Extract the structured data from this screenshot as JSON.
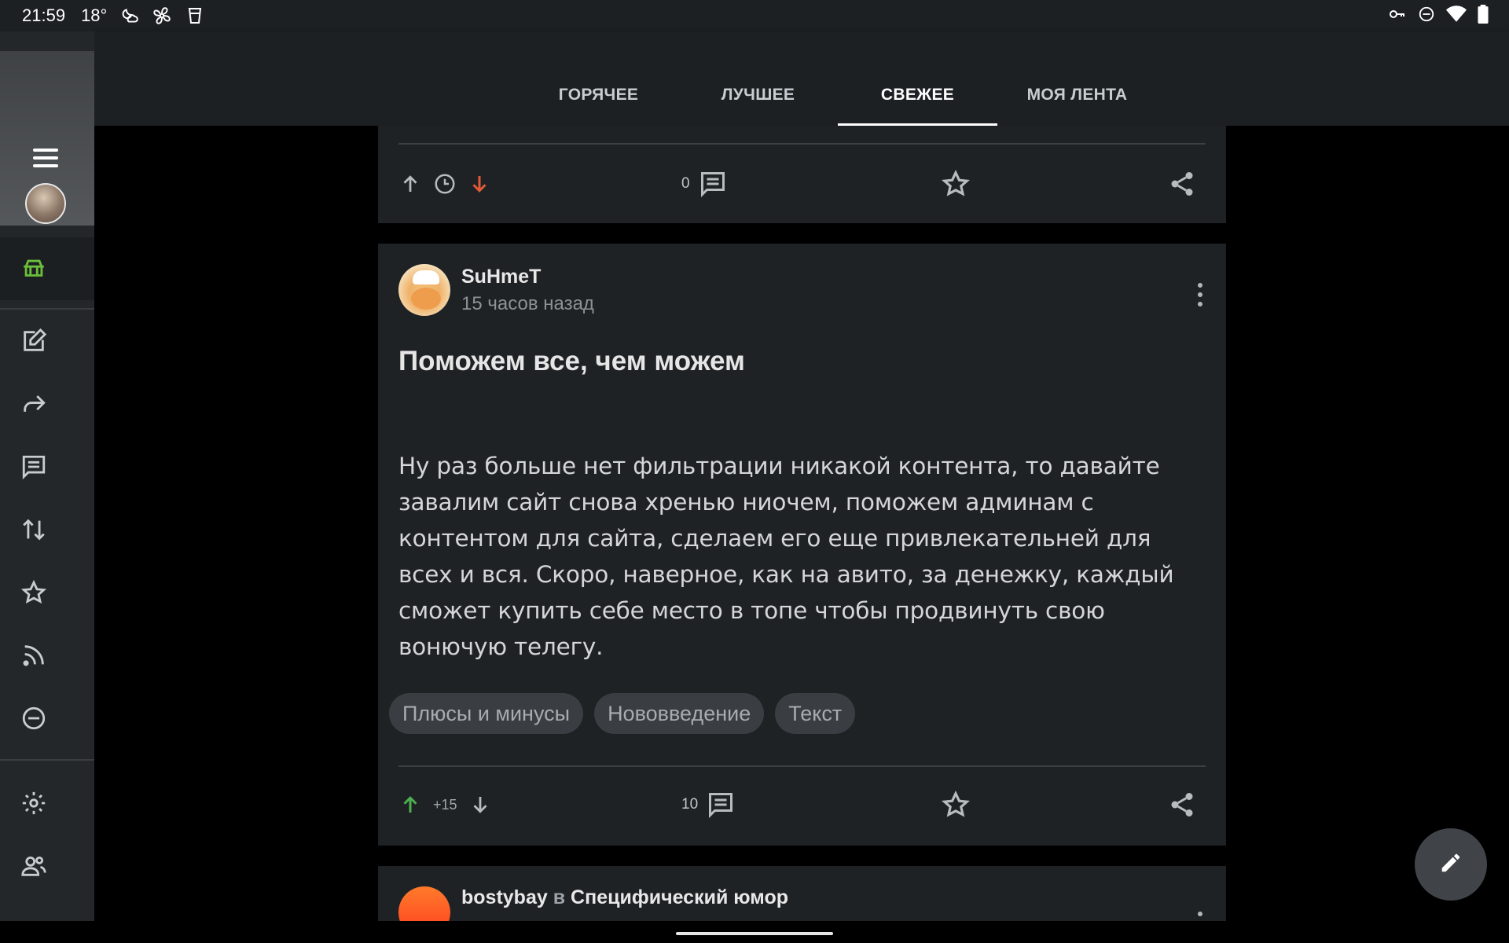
{
  "status_bar": {
    "time": "21:59",
    "temperature": "18°"
  },
  "tabs": [
    {
      "label": "ГОРЯЧЕЕ",
      "active": false
    },
    {
      "label": "ЛУЧШЕЕ",
      "active": false
    },
    {
      "label": "СВЕЖЕЕ",
      "active": true
    },
    {
      "label": "МОЯ ЛЕНТА",
      "active": false
    }
  ],
  "rail": {
    "items": [
      "home-icon",
      "edit-icon",
      "share-icon",
      "comment-icon",
      "sort-icon",
      "star-icon",
      "rss-icon",
      "block-icon",
      "settings-icon",
      "people-icon"
    ],
    "active_item": "home-icon"
  },
  "prev_post": {
    "comment_count": "0"
  },
  "post": {
    "author": "SuHmeT",
    "time_ago": "15 часов назад",
    "title": "Поможем все, чем можем",
    "body": "Ну раз больше нет фильтрации никакой контента, то давайте завалим сайт снова хренью ниочем, поможем админам с контентом для сайта, сделаем его еще привлекательней для всех и вся. Скоро, наверное, как на авито, за денежку, каждый сможет купить себе место в топе чтобы продвинуть свою вонючую телегу.",
    "tags": [
      "Плюсы и минусы",
      "Нововведение",
      "Текст"
    ],
    "rating": "+15",
    "comment_count": "10"
  },
  "next_post": {
    "author": "bostybay",
    "in_word": "в",
    "community": "Специфический юмор"
  },
  "colors": {
    "upvote_active": "#4caf50",
    "downvote_active": "#e05a3a",
    "home_active": "#6bbf3a"
  }
}
